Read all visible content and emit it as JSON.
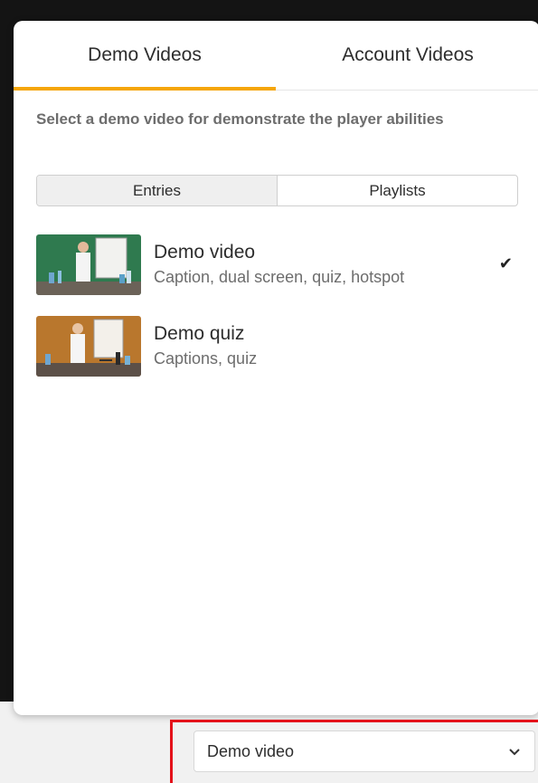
{
  "tabs": [
    {
      "label": "Demo Videos",
      "active": true
    },
    {
      "label": "Account Videos",
      "active": false
    }
  ],
  "description": "Select a demo video for demonstrate the player abilities",
  "segmented": {
    "entries_label": "Entries",
    "playlists_label": "Playlists",
    "selected": "Entries"
  },
  "videos": [
    {
      "title": "Demo video",
      "subtitle": "Caption, dual screen, quiz, hotspot",
      "selected": true,
      "check_icon": "✔"
    },
    {
      "title": "Demo quiz",
      "subtitle": "Captions, quiz",
      "selected": false
    }
  ],
  "selector": {
    "value": "Demo video",
    "icon": "chevron-down-icon"
  },
  "colors": {
    "accent": "#f5a60a",
    "highlight": "#e4121a",
    "thumb1_bg": "#2f7a4f",
    "thumb2_bg": "#b9772d"
  }
}
